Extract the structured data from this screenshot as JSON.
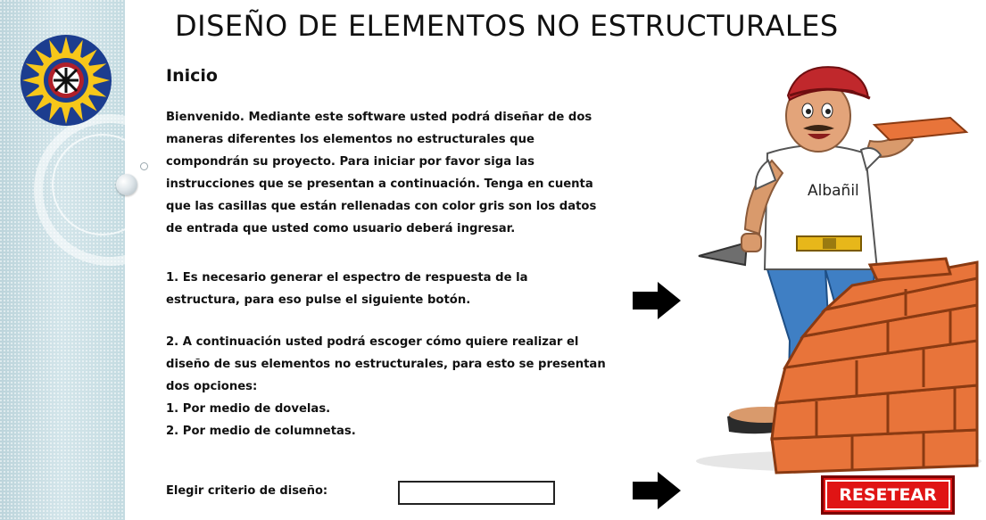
{
  "header": {
    "title": "DISEÑO DE ELEMENTOS NO ESTRUCTURALES",
    "section": "Inicio"
  },
  "intro": {
    "lines": [
      "Bienvenido. Mediante este software usted podrá diseñar de dos",
      "maneras diferentes los elementos no estructurales que",
      "compondrán su proyecto. Para iniciar por favor siga las",
      "instrucciones que se presentan a continuación. Tenga en cuenta",
      "que las casillas que están rellenadas con color gris son los datos",
      "de entrada que usted como usuario deberá ingresar."
    ]
  },
  "step1": {
    "lines": [
      "1. Es necesario generar el espectro de respuesta de la",
      "estructura, para eso pulse el siguiente botón."
    ]
  },
  "step2": {
    "lines": [
      "2. A continuación usted podrá escoger cómo quiere realizar el",
      "diseño de sus elementos no estructurales, para esto se presentan",
      "dos opciones:",
      "1. Por medio de dovelas.",
      "2. Por medio de columnetas."
    ]
  },
  "criteria": {
    "label": "Elegir criterio de diseño:",
    "value": ""
  },
  "reset_button": {
    "label": "RESETEAR"
  },
  "illustration": {
    "shirt_text": "Albañil"
  },
  "icons": {
    "logo": "university-seal-icon",
    "arrow": "right-arrow-icon"
  },
  "colors": {
    "reset_bg": "#e01414",
    "sidebar": "#c9dde3",
    "logo_blue": "#1c3d8f",
    "logo_yellow": "#f7c71a"
  }
}
